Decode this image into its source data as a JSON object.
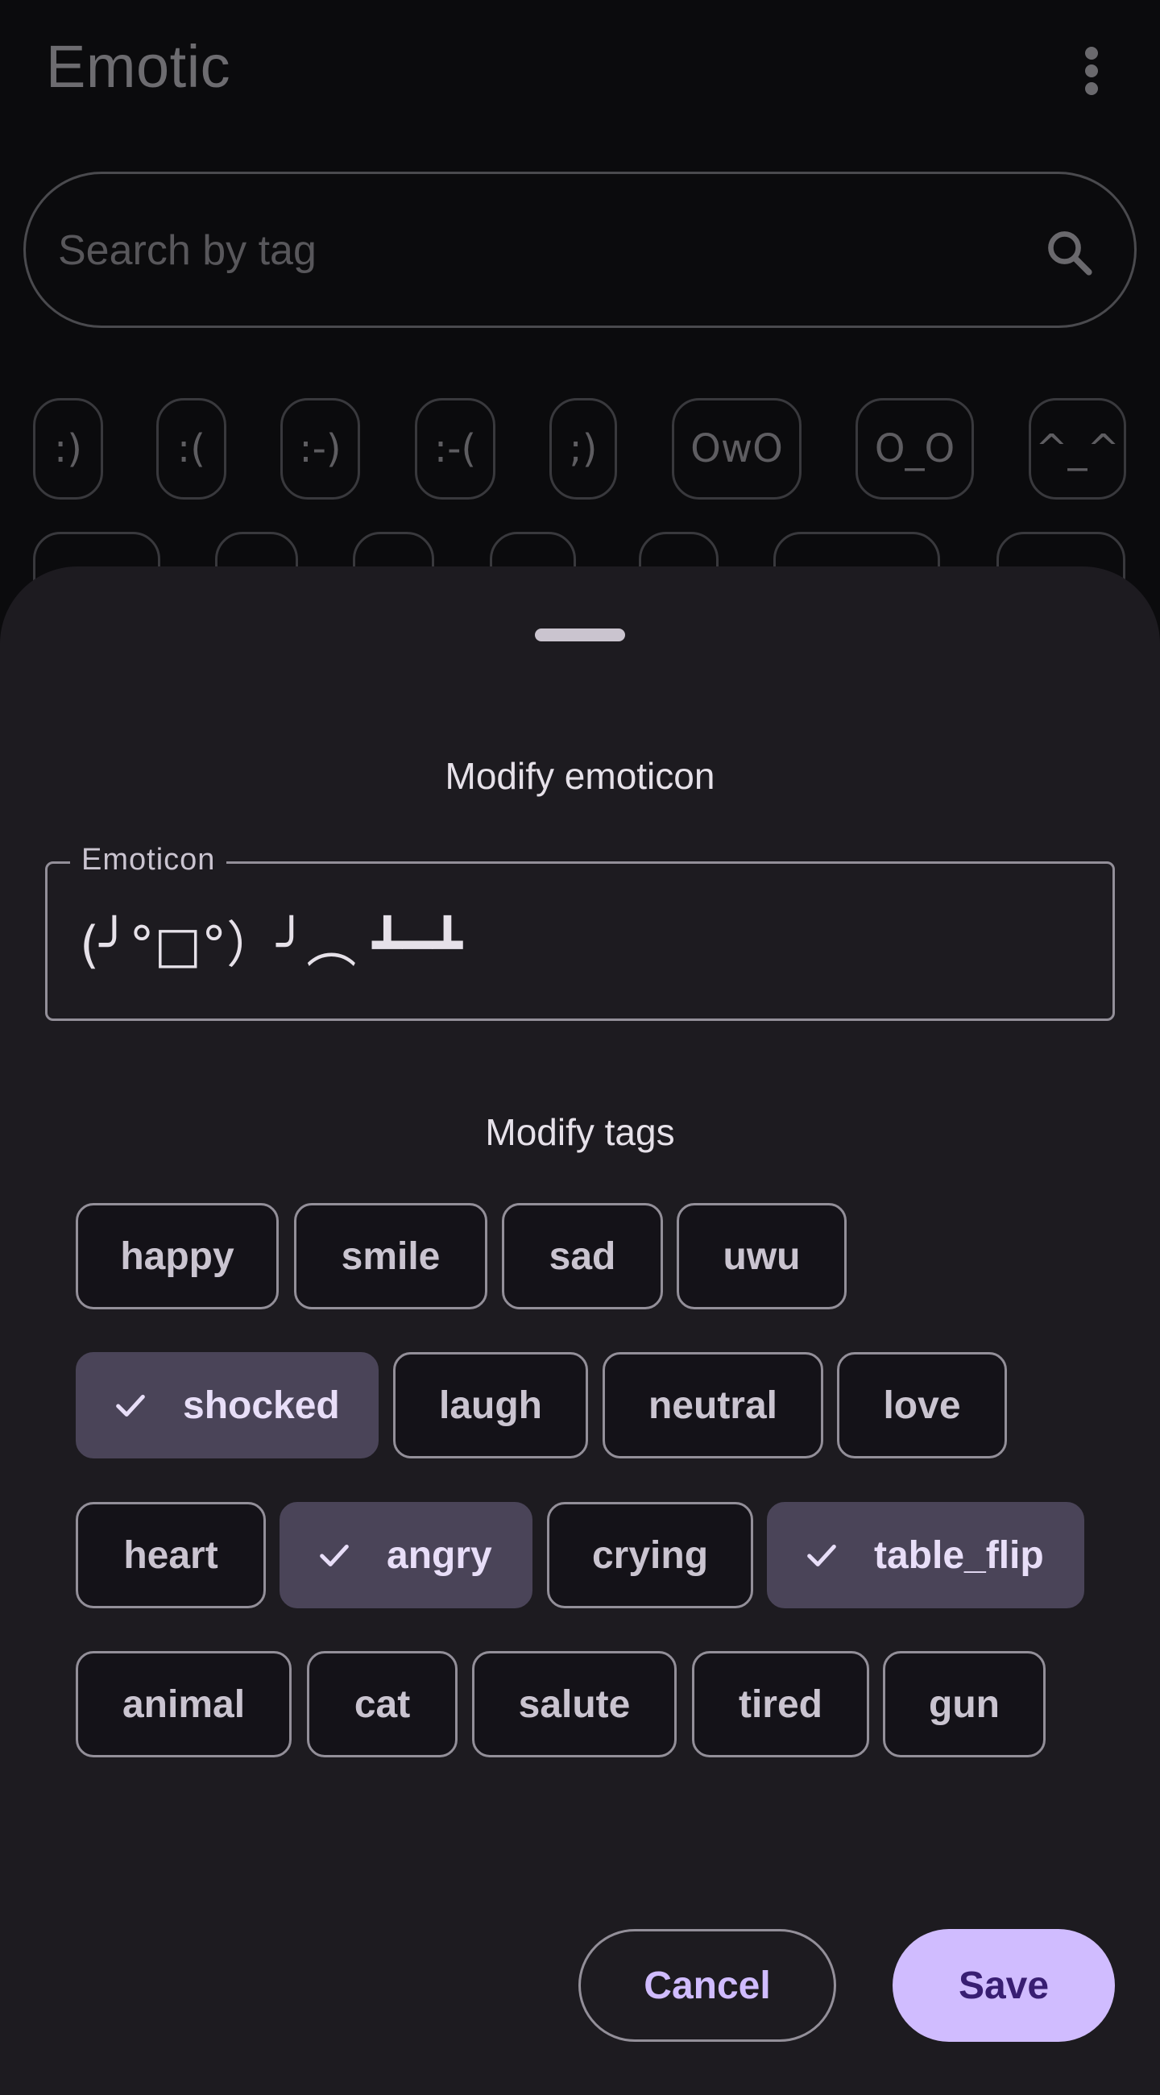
{
  "app": {
    "title": "Emotic",
    "menu_icon": "more-vert-icon"
  },
  "search": {
    "placeholder": "Search by tag",
    "icon": "search-icon"
  },
  "emoticon_grid": {
    "row1": [
      ":)",
      ":(",
      ":-)",
      ":-(",
      ";)",
      "OwO",
      "O_O",
      "^_^"
    ]
  },
  "sheet": {
    "title": "Modify emoticon",
    "emoticon_label": "Emoticon",
    "emoticon_value": "(╯°□°）╯︵ ┻━┻",
    "tags_title": "Modify tags",
    "tags": [
      {
        "label": "happy",
        "selected": false
      },
      {
        "label": "smile",
        "selected": false
      },
      {
        "label": "sad",
        "selected": false
      },
      {
        "label": "uwu",
        "selected": false
      },
      {
        "label": "shocked",
        "selected": true
      },
      {
        "label": "laugh",
        "selected": false
      },
      {
        "label": "neutral",
        "selected": false
      },
      {
        "label": "love",
        "selected": false
      },
      {
        "label": "heart",
        "selected": false
      },
      {
        "label": "angry",
        "selected": true
      },
      {
        "label": "crying",
        "selected": false
      },
      {
        "label": "table_flip",
        "selected": true
      },
      {
        "label": "animal",
        "selected": false
      },
      {
        "label": "cat",
        "selected": false
      },
      {
        "label": "salute",
        "selected": false
      },
      {
        "label": "tired",
        "selected": false
      },
      {
        "label": "gun",
        "selected": false
      }
    ],
    "cancel_label": "Cancel",
    "save_label": "Save"
  },
  "colors": {
    "accent": "#d0bcff",
    "on_accent": "#381e72",
    "selected_chip": "#4a4458",
    "surface": "#1d1b20"
  }
}
